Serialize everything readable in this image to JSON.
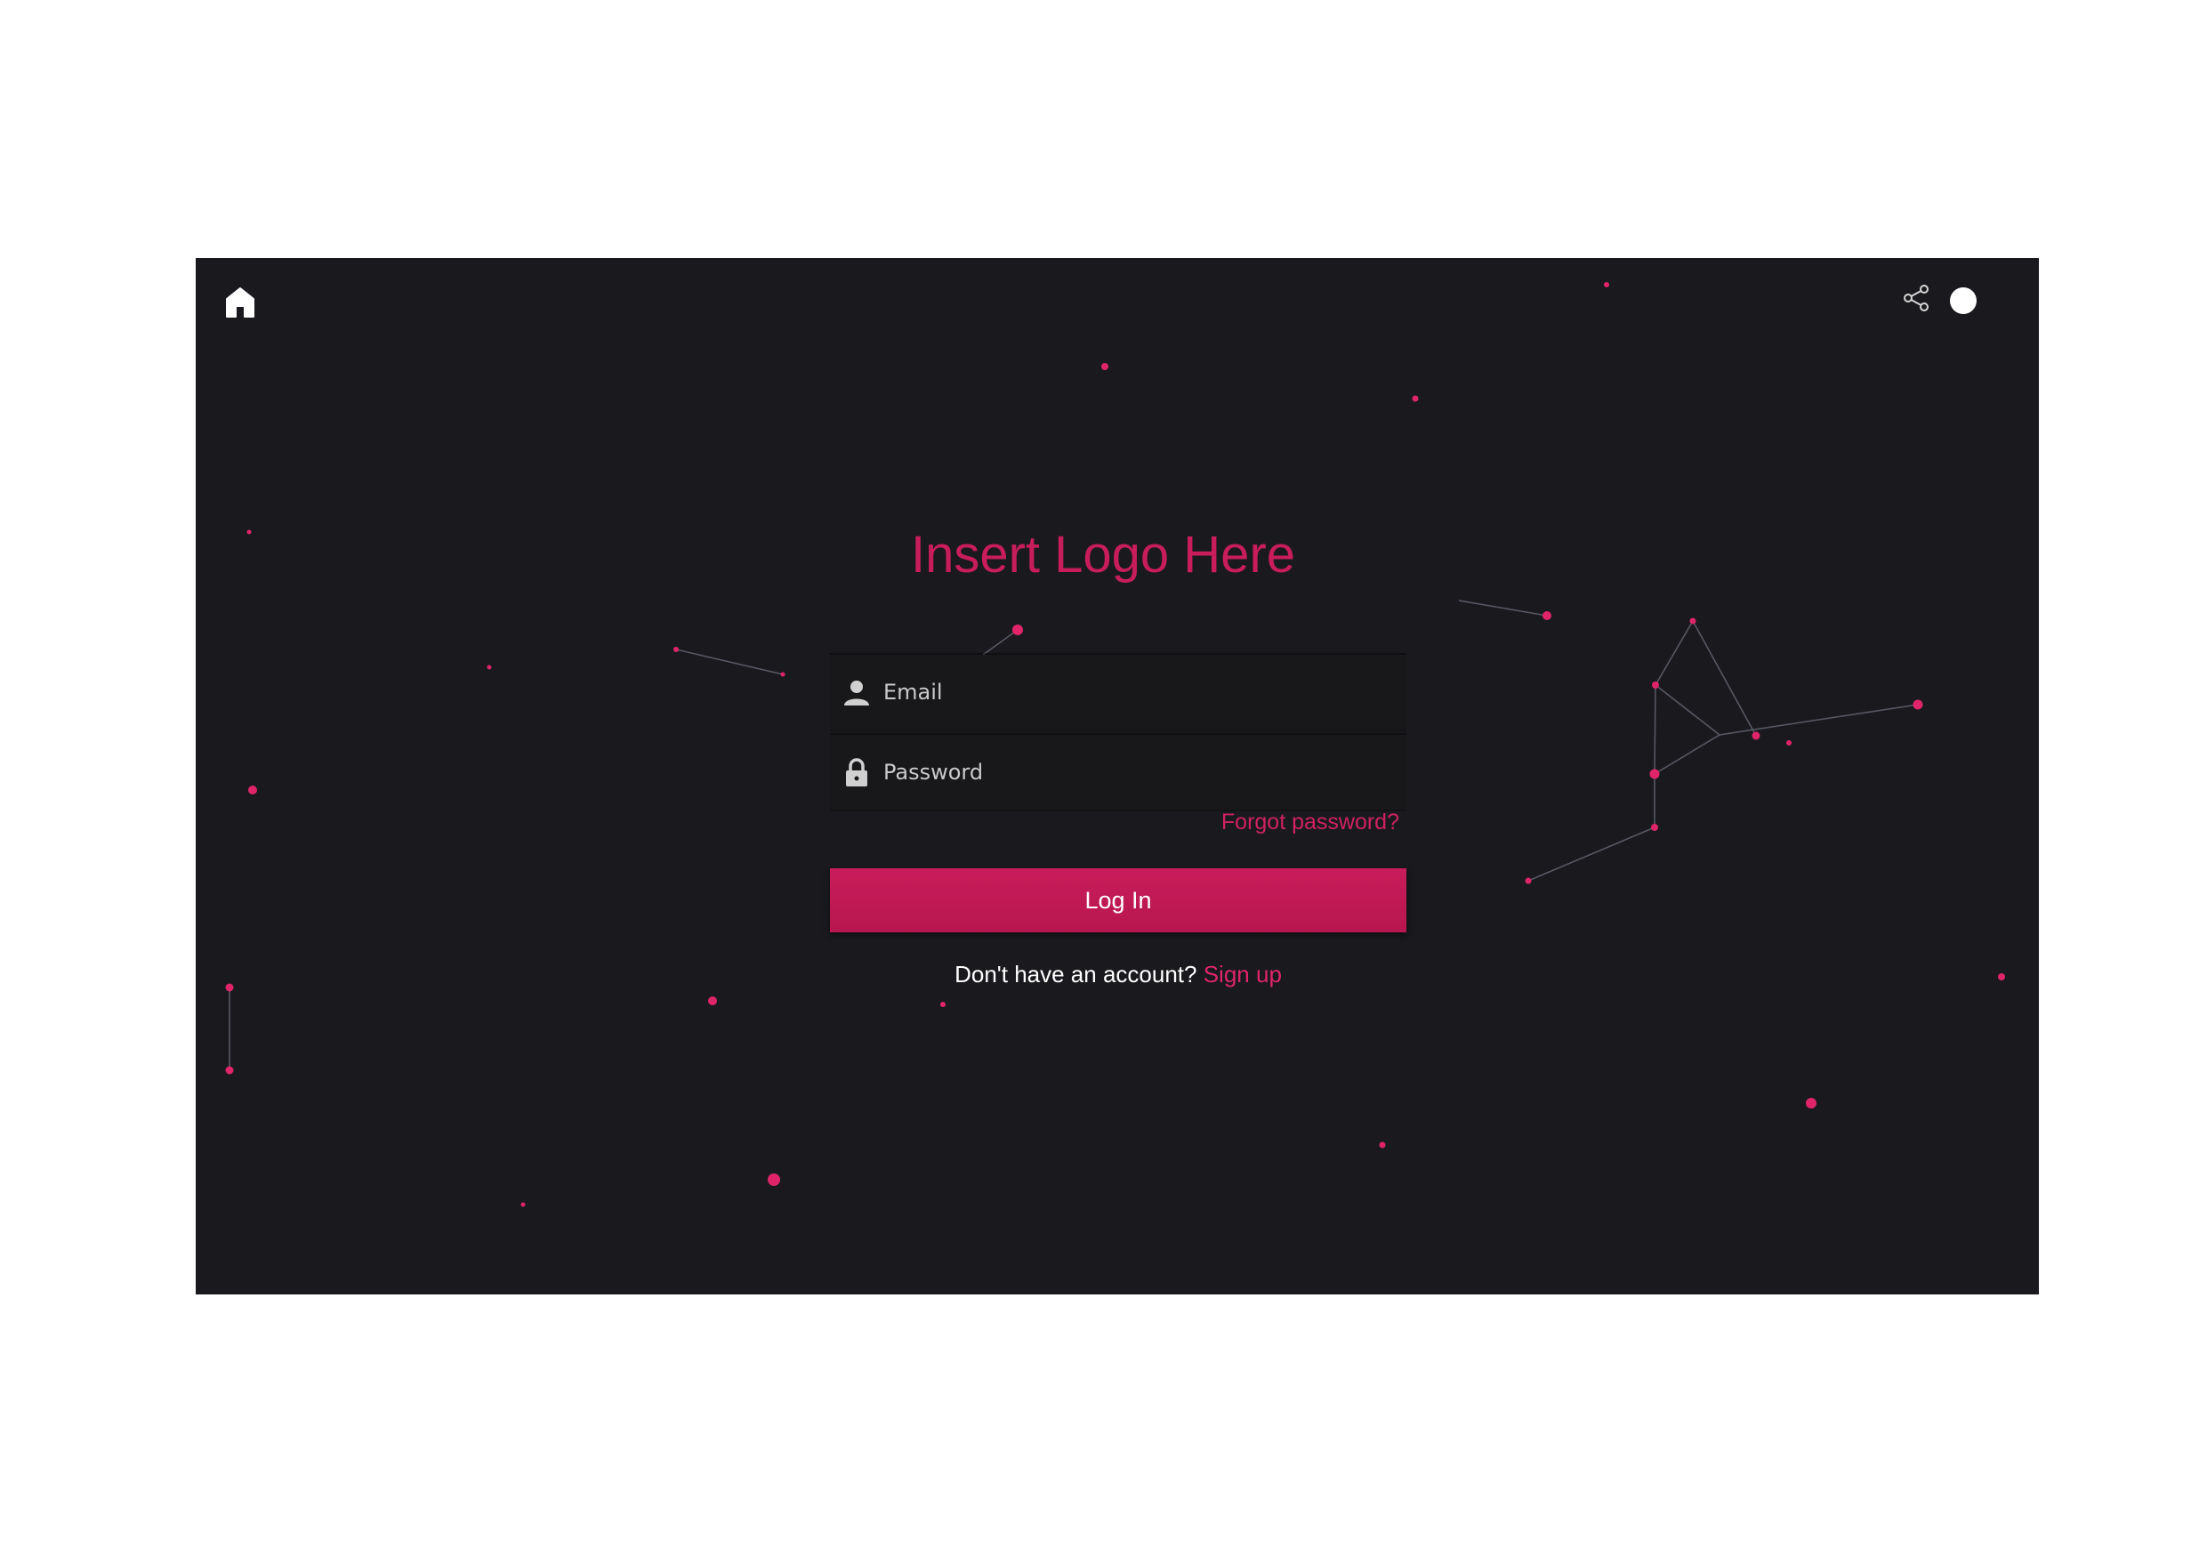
{
  "header": {
    "home_icon": "home-icon",
    "share_icon": "share-icon",
    "theme_toggle": "theme-toggle-icon"
  },
  "logo": {
    "text": "Insert Logo Here"
  },
  "form": {
    "email": {
      "placeholder": "Email",
      "icon": "user-icon",
      "value": ""
    },
    "password": {
      "placeholder": "Password",
      "icon": "lock-icon",
      "value": ""
    },
    "forgot_label": "Forgot password?",
    "login_label": "Log In",
    "signup_prompt": "Don't have an account?",
    "signup_label": "Sign up"
  },
  "colors": {
    "background": "#1a1a1e",
    "accent": "#c81d5a",
    "particle": "#e0246a",
    "page": "#ffffff"
  }
}
